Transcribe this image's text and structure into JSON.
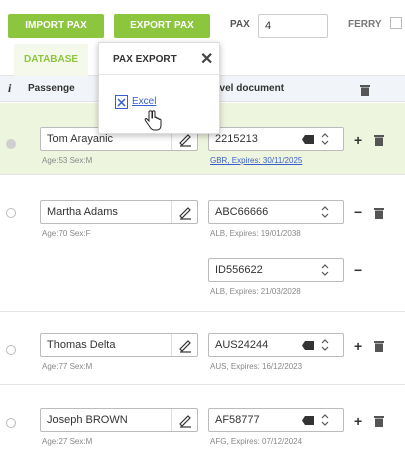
{
  "toolbar": {
    "import_label": "IMPORT PAX",
    "export_label": "EXPORT PAX",
    "pax_label": "PAX",
    "pax_value": "4",
    "ferry_label": "FERRY"
  },
  "tabs": {
    "database_label": "DATABASE"
  },
  "table": {
    "info_header": "i",
    "passenger_header": "Passenge",
    "document_header": "avel document"
  },
  "dropdown": {
    "title": "PAX EXPORT",
    "item_label": "Excel"
  },
  "passengers": [
    {
      "name": "Tom Arayanic",
      "meta": "Age:53 Sex:M",
      "docs": [
        {
          "number": "2215213",
          "meta": "GBR, Expires: 30/11/2025"
        }
      ]
    },
    {
      "name": "Martha Adams",
      "meta": "Age:70 Sex:F",
      "docs": [
        {
          "number": "ABC66666",
          "meta": "ALB, Expires: 19/01/2038"
        },
        {
          "number": "ID556622",
          "meta": "ALB, Expires: 21/03/2028"
        }
      ]
    },
    {
      "name": "Thomas Delta",
      "meta": "Age:77 Sex:M",
      "docs": [
        {
          "number": "AUS24244",
          "meta": "AUS, Expires: 16/12/2023"
        }
      ]
    },
    {
      "name": "Joseph  BROWN",
      "meta": "Age:27 Sex:M",
      "docs": [
        {
          "number": "AF58777",
          "meta": "AFG, Expires: 07/12/2024"
        }
      ]
    }
  ],
  "colors": {
    "accent_green": "#8cc63f",
    "selected_row": "#eef5df",
    "link_blue": "#3a5fcd"
  }
}
